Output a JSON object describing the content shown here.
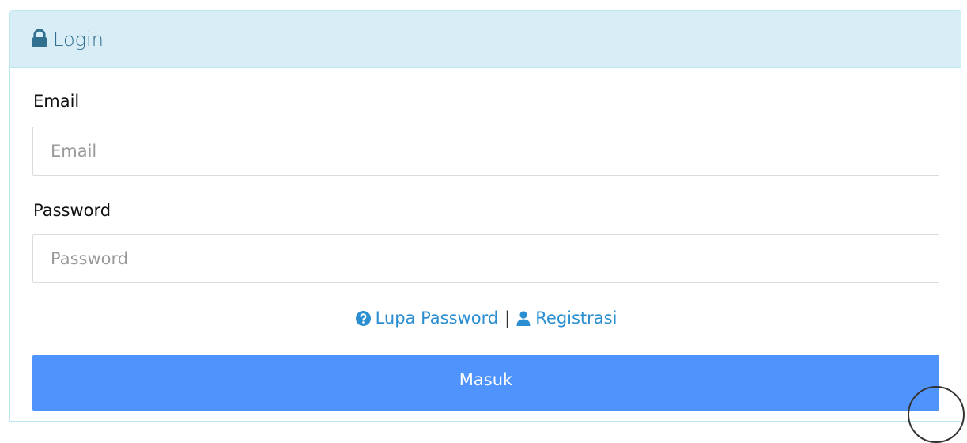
{
  "panel": {
    "title": "Login",
    "title_icon": "lock-icon"
  },
  "form": {
    "email": {
      "label": "Email",
      "placeholder": "Email",
      "value": ""
    },
    "password": {
      "label": "Password",
      "placeholder": "Password",
      "value": ""
    },
    "links": {
      "forgot_password": {
        "label": "Lupa Password",
        "icon": "question-circle-icon"
      },
      "separator": "|",
      "register": {
        "label": "Registrasi",
        "icon": "user-icon"
      }
    },
    "submit_label": "Masuk"
  },
  "colors": {
    "heading_bg": "#d9edf7",
    "heading_text": "#31708f",
    "link": "#2a8ed0",
    "button_bg": "#4f94fc"
  }
}
